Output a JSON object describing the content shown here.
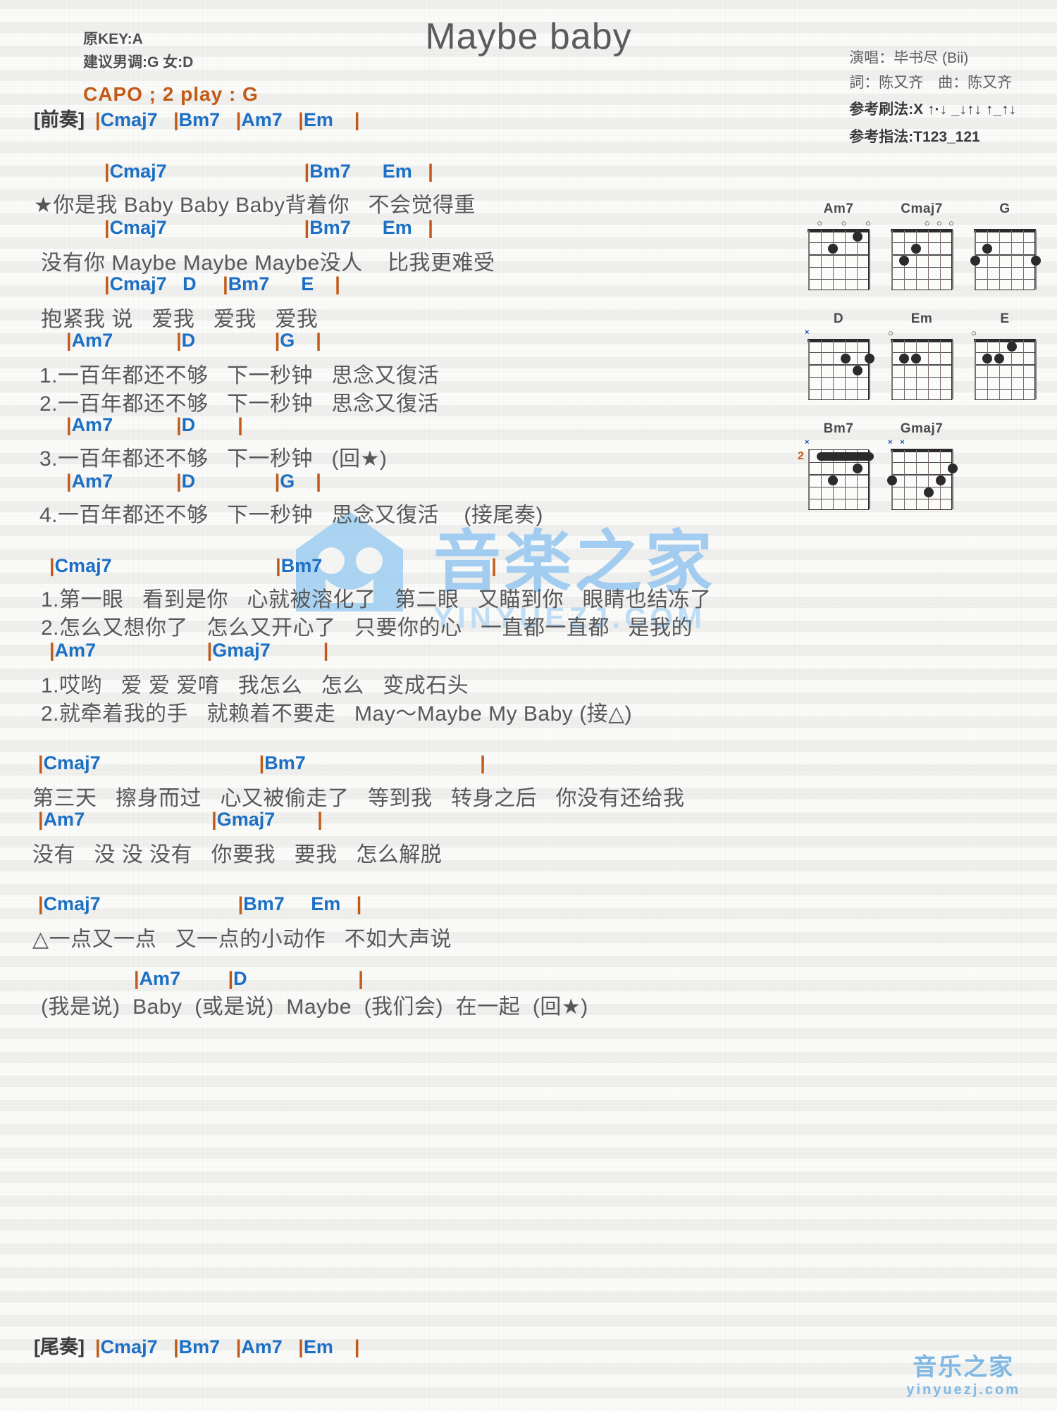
{
  "title": "Maybe baby",
  "header": {
    "key_line": "原KEY:A",
    "suggest_line": "建议男调:G 女:D",
    "capo_line": "CAPO ; 2 play : G",
    "singer": "演唱：毕书尽 (Bii)",
    "writer": "詞：陈又齐　曲：陈又齐",
    "strum": "参考刷法:X ↑·↓ _↓↑↓ ↑_↑↓",
    "finger": "参考指法:T123_121"
  },
  "intro": {
    "tag": "[前奏]",
    "chords": "|Cmaj7   |Bm7   |Am7   |Em    |"
  },
  "outro": {
    "tag": "[尾奏]",
    "chords": "|Cmaj7   |Bm7   |Am7   |Em    |"
  },
  "sections": [
    {
      "lines": [
        {
          "type": "chord",
          "text": "|Cmaj7                          |Bm7      Em   |"
        },
        {
          "type": "lyric",
          "text": "★你是我 Baby Baby Baby背着你   不会觉得重"
        },
        {
          "type": "chord",
          "text": "|Cmaj7                          |Bm7      Em   |"
        },
        {
          "type": "lyric",
          "text": "没有你 Maybe Maybe Maybe没人    比我更难受"
        },
        {
          "type": "chord",
          "text": "|Cmaj7   D     |Bm7      E    |"
        },
        {
          "type": "lyric",
          "text": "抱紧我 说   爱我   爱我   爱我"
        }
      ]
    },
    {
      "lines": [
        {
          "type": "chord",
          "text": "|Am7            |D               |G    |"
        },
        {
          "type": "lyric",
          "text": "1.一百年都还不够   下一秒钟   思念又復活"
        },
        {
          "type": "lyric",
          "text": "2.一百年都还不够   下一秒钟   思念又復活"
        },
        {
          "type": "chord",
          "text": "|Am7            |D        |"
        },
        {
          "type": "lyric",
          "text": "3.一百年都还不够   下一秒钟   (回★)"
        },
        {
          "type": "chord",
          "text": "|Am7            |D               |G    |"
        },
        {
          "type": "lyric",
          "text": "4.一百年都还不够   下一秒钟   思念又復活    (接尾奏)"
        }
      ]
    },
    {
      "lines": [
        {
          "type": "chord",
          "text": "|Cmaj7                               |Bm7                                |"
        },
        {
          "type": "lyric",
          "text": "1.第一眼   看到是你   心就被溶化了   第二眼   又瞄到你   眼睛也结冻了"
        },
        {
          "type": "lyric",
          "text": "2.怎么又想你了   怎么又开心了   只要你的心   一直都一直都   是我的"
        },
        {
          "type": "chord",
          "text": "|Am7                     |Gmaj7          |"
        },
        {
          "type": "lyric",
          "text": "1.哎哟   爱 爱 爱唷   我怎么   怎么   变成石头"
        },
        {
          "type": "lyric",
          "text": "2.就牵着我的手   就赖着不要走   May～Maybe My Baby (接△)"
        }
      ]
    },
    {
      "lines": [
        {
          "type": "chord",
          "text": "|Cmaj7                              |Bm7                                 |"
        },
        {
          "type": "lyric",
          "text": "第三天   擦身而过   心又被偷走了   等到我   转身之后   你没有还给我"
        },
        {
          "type": "chord",
          "text": "|Am7                        |Gmaj7        |"
        },
        {
          "type": "lyric",
          "text": "没有   没 没 没有   你要我   要我   怎么解脱"
        }
      ]
    },
    {
      "lines": [
        {
          "type": "chord",
          "text": "|Cmaj7                          |Bm7     Em   |"
        },
        {
          "type": "lyric",
          "text": "△一点又一点   又一点的小动作   不如大声说"
        },
        {
          "type": "chord",
          "text": "|Am7         |D                     |"
        },
        {
          "type": "lyric",
          "text": "(我是说)  Baby  (或是说)  Maybe  (我们会)  在一起  (回★)"
        }
      ]
    }
  ],
  "chord_diagrams": [
    [
      {
        "name": "Am7",
        "frets": "x02010",
        "markers": [
          "o",
          "o",
          "o"
        ]
      },
      {
        "name": "Cmaj7",
        "frets": "x32000",
        "markers": [
          "o",
          "o",
          "o"
        ]
      },
      {
        "name": "G",
        "frets": "320003",
        "markers": []
      }
    ],
    [
      {
        "name": "D",
        "frets": "xx0232",
        "markers": [
          "x"
        ]
      },
      {
        "name": "Em",
        "frets": "022000",
        "markers": [
          "o"
        ]
      },
      {
        "name": "E",
        "frets": "022100",
        "markers": [
          "o"
        ]
      }
    ],
    [
      {
        "name": "Bm7",
        "frets": "x24232",
        "markers": [
          "x"
        ],
        "barre": true,
        "position": "2"
      },
      {
        "name": "Gmaj7",
        "frets": "xx5432",
        "markers": [
          "x",
          "x"
        ]
      }
    ]
  ],
  "watermark": {
    "center_main": "音楽之家",
    "center_sub": "YINYUEZJ.COM",
    "bottom_main": "音乐之家",
    "bottom_sub": "yinyuezj.com"
  },
  "colors": {
    "chord": "#1b6fc4",
    "bar": "#c15a16",
    "capo": "#c15a16",
    "lyric": "#58585a",
    "watermark": "#9ecbf0"
  }
}
